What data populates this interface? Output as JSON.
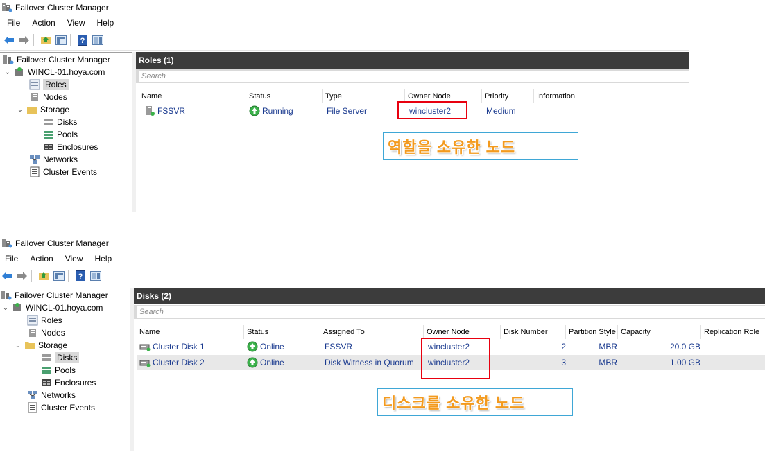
{
  "app": {
    "title": "Failover Cluster Manager",
    "menu": [
      "File",
      "Action",
      "View",
      "Help"
    ]
  },
  "tree": {
    "root": "Failover Cluster Manager",
    "cluster": "WINCL-01.hoya.com",
    "items": {
      "roles": "Roles",
      "nodes": "Nodes",
      "storage": "Storage",
      "disks": "Disks",
      "pools": "Pools",
      "enclosures": "Enclosures",
      "networks": "Networks",
      "events": "Cluster Events"
    }
  },
  "roles_view": {
    "header": "Roles (1)",
    "search_placeholder": "Search",
    "columns": [
      "Name",
      "Status",
      "Type",
      "Owner Node",
      "Priority",
      "Information"
    ],
    "rows": [
      {
        "name": "FSSVR",
        "status": "Running",
        "type": "File Server",
        "owner": "wincluster2",
        "priority": "Medium",
        "information": ""
      }
    ],
    "callout": "역할을 소유한 노드"
  },
  "disks_view": {
    "header": "Disks (2)",
    "search_placeholder": "Search",
    "columns": [
      "Name",
      "Status",
      "Assigned To",
      "Owner Node",
      "Disk Number",
      "Partition Style",
      "Capacity",
      "Replication Role"
    ],
    "rows": [
      {
        "name": "Cluster Disk 1",
        "status": "Online",
        "assigned": "FSSVR",
        "owner": "wincluster2",
        "disk_number": "2",
        "partition": "MBR",
        "capacity": "20.0 GB"
      },
      {
        "name": "Cluster Disk 2",
        "status": "Online",
        "assigned": "Disk Witness in Quorum",
        "owner": "wincluster2",
        "disk_number": "3",
        "partition": "MBR",
        "capacity": "1.00 GB"
      }
    ],
    "callout": "디스크를 소유한 노드"
  },
  "colors": {
    "highlight_box": "#e8000f",
    "callout_text": "#f39a1e",
    "callout_border": "#3fa7d6",
    "header_bg": "#3c3c3c",
    "link_text": "#1a3a8f"
  }
}
